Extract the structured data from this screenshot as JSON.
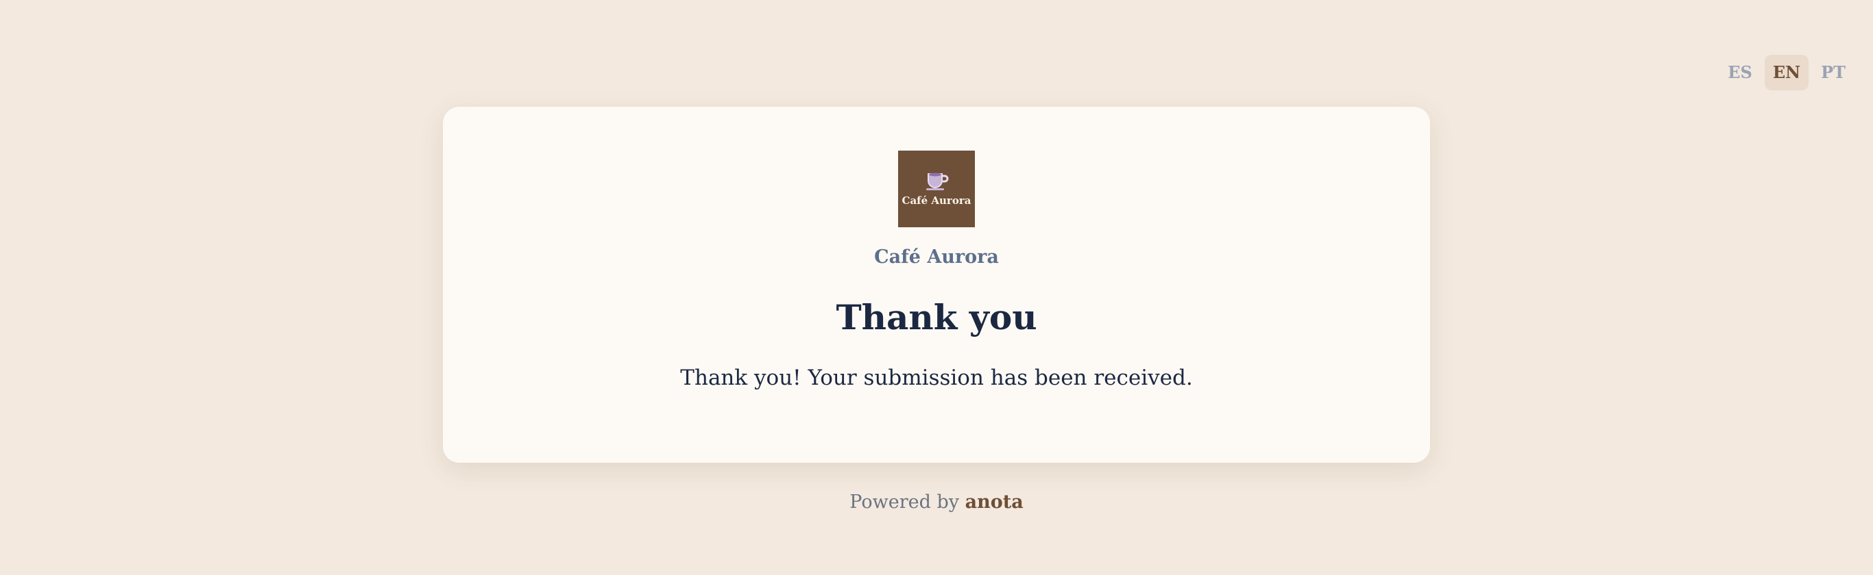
{
  "language_switch": {
    "options": [
      {
        "code": "ES",
        "active": false
      },
      {
        "code": "EN",
        "active": true
      },
      {
        "code": "PT",
        "active": false
      }
    ]
  },
  "card": {
    "logo": {
      "icon": "coffee-cup-icon",
      "text": "Café Aurora"
    },
    "business_name": "Café Aurora",
    "title": "Thank you",
    "message": "Thank you! Your submission has been received."
  },
  "footer": {
    "powered_by_label": "Powered by",
    "brand": "anota"
  },
  "colors": {
    "background": "#f3e9de",
    "card": "#fdfaf5",
    "brand_brown": "#6f4e37",
    "heading": "#1c2841",
    "muted": "#5e6f8c"
  }
}
